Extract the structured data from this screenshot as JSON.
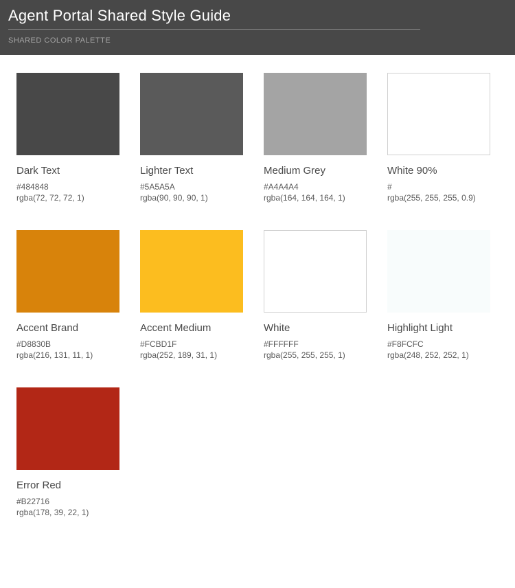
{
  "header": {
    "title": "Agent Portal Shared Style Guide",
    "section": "Shared Color Palette"
  },
  "swatches": [
    {
      "name": "Dark Text",
      "hex": "#484848",
      "rgba": "rgba(72, 72, 72, 1)",
      "bg": "#484848",
      "border": false
    },
    {
      "name": "Lighter Text",
      "hex": "#5A5A5A",
      "rgba": "rgba(90, 90, 90, 1)",
      "bg": "#5A5A5A",
      "border": false
    },
    {
      "name": "Medium Grey",
      "hex": "#A4A4A4",
      "rgba": "rgba(164, 164, 164, 1)",
      "bg": "#A4A4A4",
      "border": false
    },
    {
      "name": "White 90%",
      "hex": "#",
      "rgba": "rgba(255, 255, 255, 0.9)",
      "bg": "rgba(255,255,255,0.9)",
      "border": true
    },
    {
      "name": "Accent Brand",
      "hex": "#D8830B",
      "rgba": "rgba(216, 131, 11, 1)",
      "bg": "#D8830B",
      "border": false
    },
    {
      "name": "Accent Medium",
      "hex": "#FCBD1F",
      "rgba": "rgba(252, 189, 31, 1)",
      "bg": "#FCBD1F",
      "border": false
    },
    {
      "name": "White",
      "hex": "#FFFFFF",
      "rgba": "rgba(255, 255, 255, 1)",
      "bg": "#FFFFFF",
      "border": true
    },
    {
      "name": "Highlight Light",
      "hex": "#F8FCFC",
      "rgba": "rgba(248, 252, 252, 1)",
      "bg": "#F8FCFC",
      "border": false
    },
    {
      "name": "Error Red",
      "hex": "#B22716",
      "rgba": "rgba(178, 39, 22, 1)",
      "bg": "#B22716",
      "border": false
    }
  ]
}
